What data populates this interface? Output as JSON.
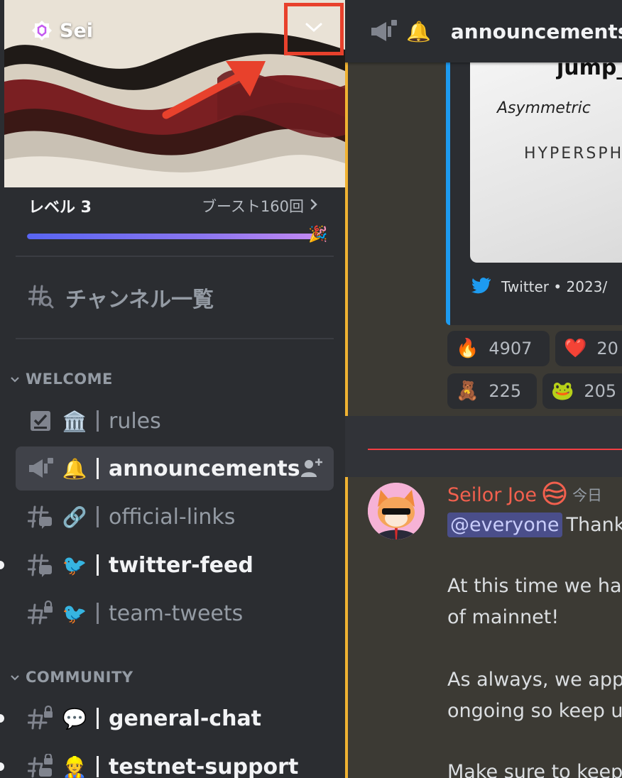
{
  "server": {
    "name": "Sei",
    "boost_level": "レベル 3",
    "boost_count": "ブースト160回",
    "boost_progress": 1.0
  },
  "sidebar": {
    "browse_channels": "チャンネル一覧",
    "categories": [
      {
        "label": "WELCOME",
        "channels": [
          {
            "name": "rules",
            "emoji": "🏛️",
            "icon": "rules-icon",
            "unread": false,
            "active": false
          },
          {
            "name": "announcements",
            "emoji": "🔔",
            "icon": "announcement-icon",
            "unread": false,
            "active": true
          },
          {
            "name": "official-links",
            "emoji": "🔗",
            "icon": "thread-hash-icon",
            "unread": false,
            "active": false
          },
          {
            "name": "twitter-feed",
            "emoji": "🐦",
            "icon": "thread-hash-icon",
            "unread": true,
            "active": false
          },
          {
            "name": "team-tweets",
            "emoji": "🐦",
            "icon": "locked-hash-icon",
            "unread": false,
            "active": false
          }
        ]
      },
      {
        "label": "COMMUNITY",
        "channels": [
          {
            "name": "general-chat",
            "emoji": "💬",
            "icon": "locked-hash-icon",
            "unread": true,
            "active": false
          },
          {
            "name": "testnet-support",
            "emoji": "👷",
            "icon": "locked-thread-icon",
            "unread": true,
            "active": false
          }
        ]
      }
    ]
  },
  "topbar": {
    "channel_name": "announcements",
    "emoji": "🔔"
  },
  "embed": {
    "image_text_1": "jump_",
    "image_text_2": "Asymmetric",
    "image_text_3": "HYPERSPH",
    "footer": "Twitter • 2023/"
  },
  "reactions": [
    {
      "emoji": "🔥",
      "count": "4907"
    },
    {
      "emoji": "❤️",
      "count": "20"
    },
    {
      "emoji": "🧸",
      "count": "225"
    },
    {
      "emoji": "🐸",
      "count": "205"
    }
  ],
  "message": {
    "author": "Seilor Joe",
    "time": "今日",
    "mention": "@everyone",
    "mention_rest": "Thank",
    "lines": [
      "At this time we ha",
      "of mainnet!",
      "As always, we app",
      "ongoing so keep u",
      "Make sure to keep"
    ]
  },
  "colors": {
    "accent": "#5865f2",
    "annotation_red": "#e8412c",
    "mention_bg": "#4a4e8a",
    "author_color": "#f2604e",
    "highlight_bar": "#f0b232"
  }
}
